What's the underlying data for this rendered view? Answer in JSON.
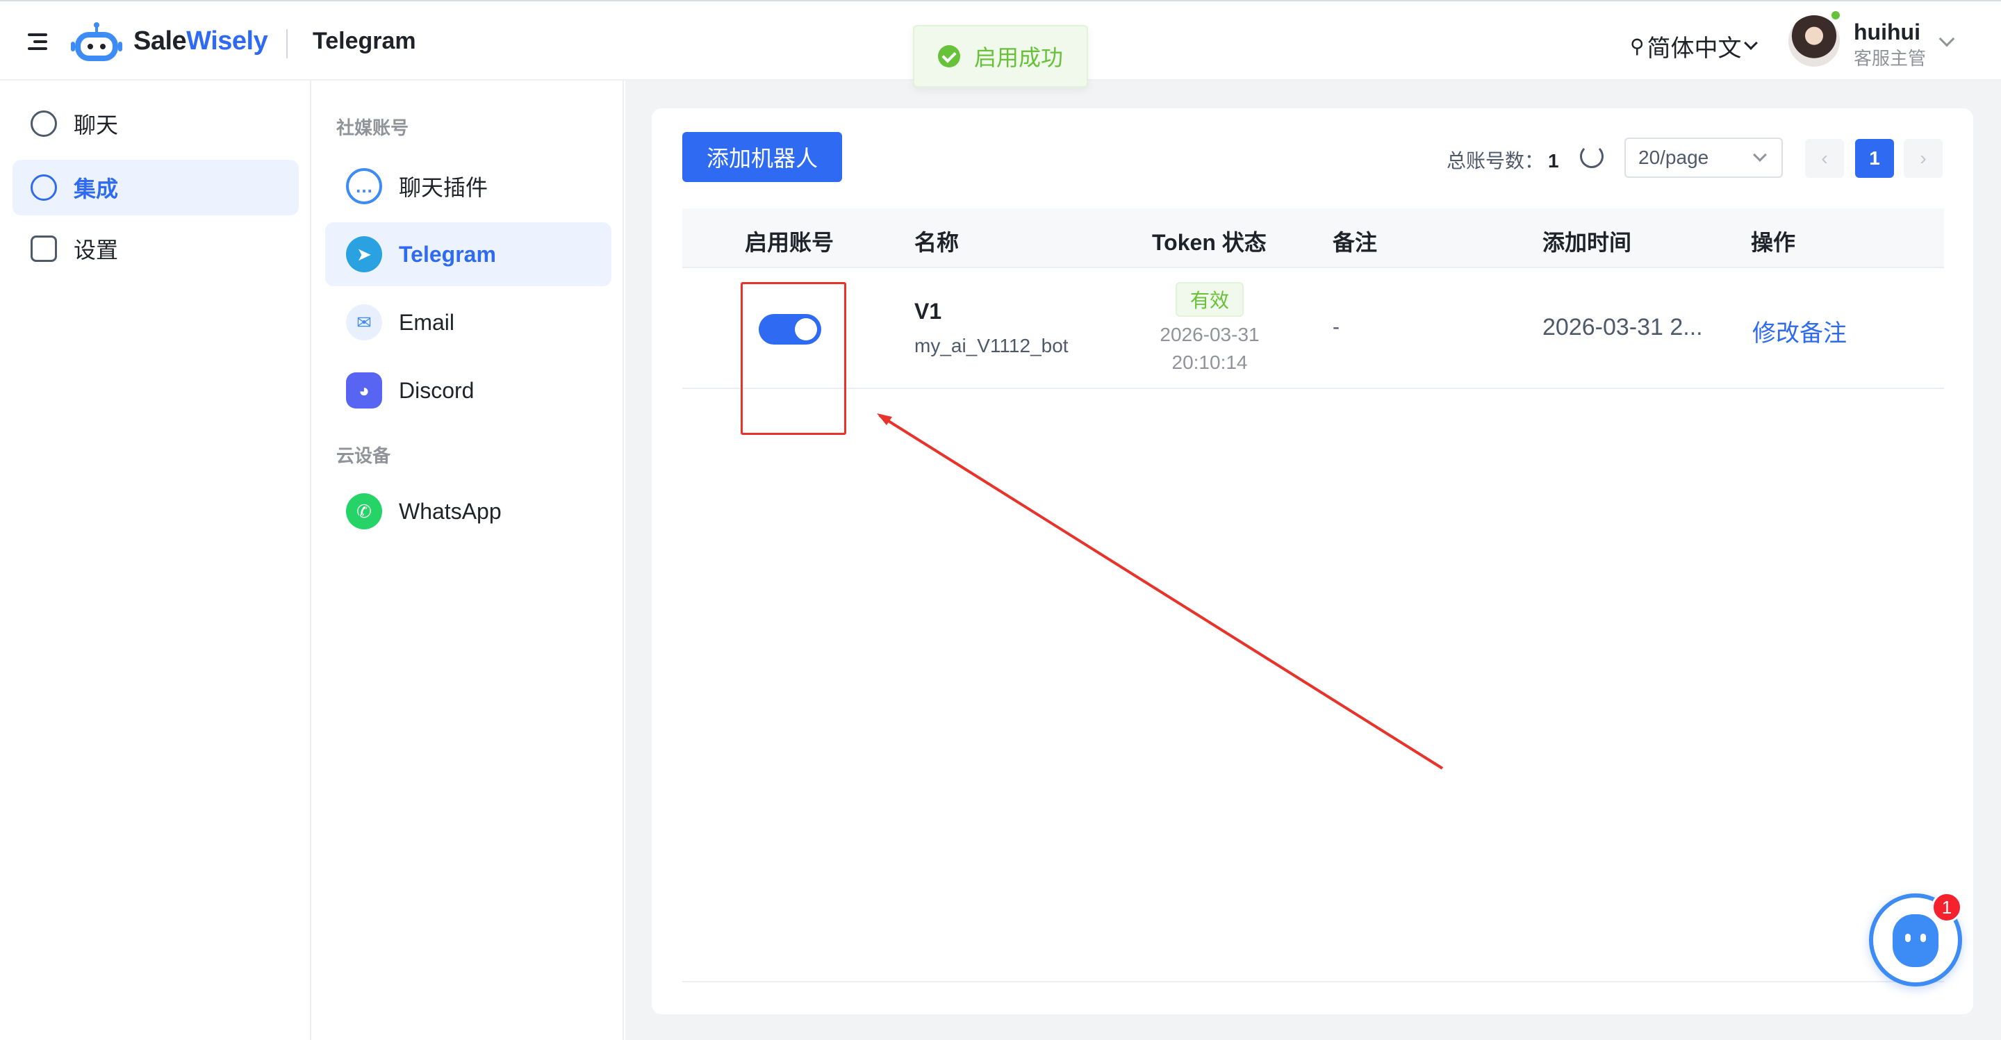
{
  "header": {
    "brand_part1": "Sale",
    "brand_part2": "Wisely",
    "page_title": "Telegram",
    "toast": "启用成功",
    "language": "简体中文",
    "user": {
      "name": "huihui",
      "role": "客服主管"
    }
  },
  "sidebar": {
    "items": [
      {
        "label": "聊天",
        "icon": "chat-bubble-icon",
        "active": false
      },
      {
        "label": "集成",
        "icon": "link-icon",
        "active": true
      },
      {
        "label": "设置",
        "icon": "settings-icon",
        "active": false
      }
    ]
  },
  "channels": {
    "group1_label": "社媒账号",
    "group2_label": "云设备",
    "items": [
      {
        "label": "聊天插件",
        "icon": "chat-plugin-icon",
        "color": "#3d8bf5"
      },
      {
        "label": "Telegram",
        "icon": "telegram-icon",
        "color": "#2aa1e0",
        "active": true
      },
      {
        "label": "Email",
        "icon": "email-icon",
        "color": "#3d8bf5"
      },
      {
        "label": "Discord",
        "icon": "discord-icon",
        "color": "#5865f2"
      },
      {
        "label": "WhatsApp",
        "icon": "whatsapp-icon",
        "color": "#25d366"
      }
    ]
  },
  "toolbar": {
    "add_button": "添加机器人",
    "total_label": "总账号数：",
    "total_value": "1",
    "page_size": "20/page",
    "current_page": "1",
    "prev": "‹",
    "next": "›"
  },
  "table": {
    "headers": [
      "启用账号",
      "名称",
      "Token 状态",
      "备注",
      "添加时间",
      "操作"
    ],
    "rows": [
      {
        "enabled": true,
        "name": "V1",
        "username": "my_ai_V1112_bot",
        "token_status": "有效",
        "token_date": "2026-03-31 20:10:14",
        "remark": "-",
        "added_time": "2026-03-31 2...",
        "action": "修改备注"
      }
    ]
  },
  "support": {
    "badge_count": "1"
  },
  "colors": {
    "primary": "#2f6bf2",
    "success": "#67c23a",
    "annotation": "#e8332a"
  }
}
